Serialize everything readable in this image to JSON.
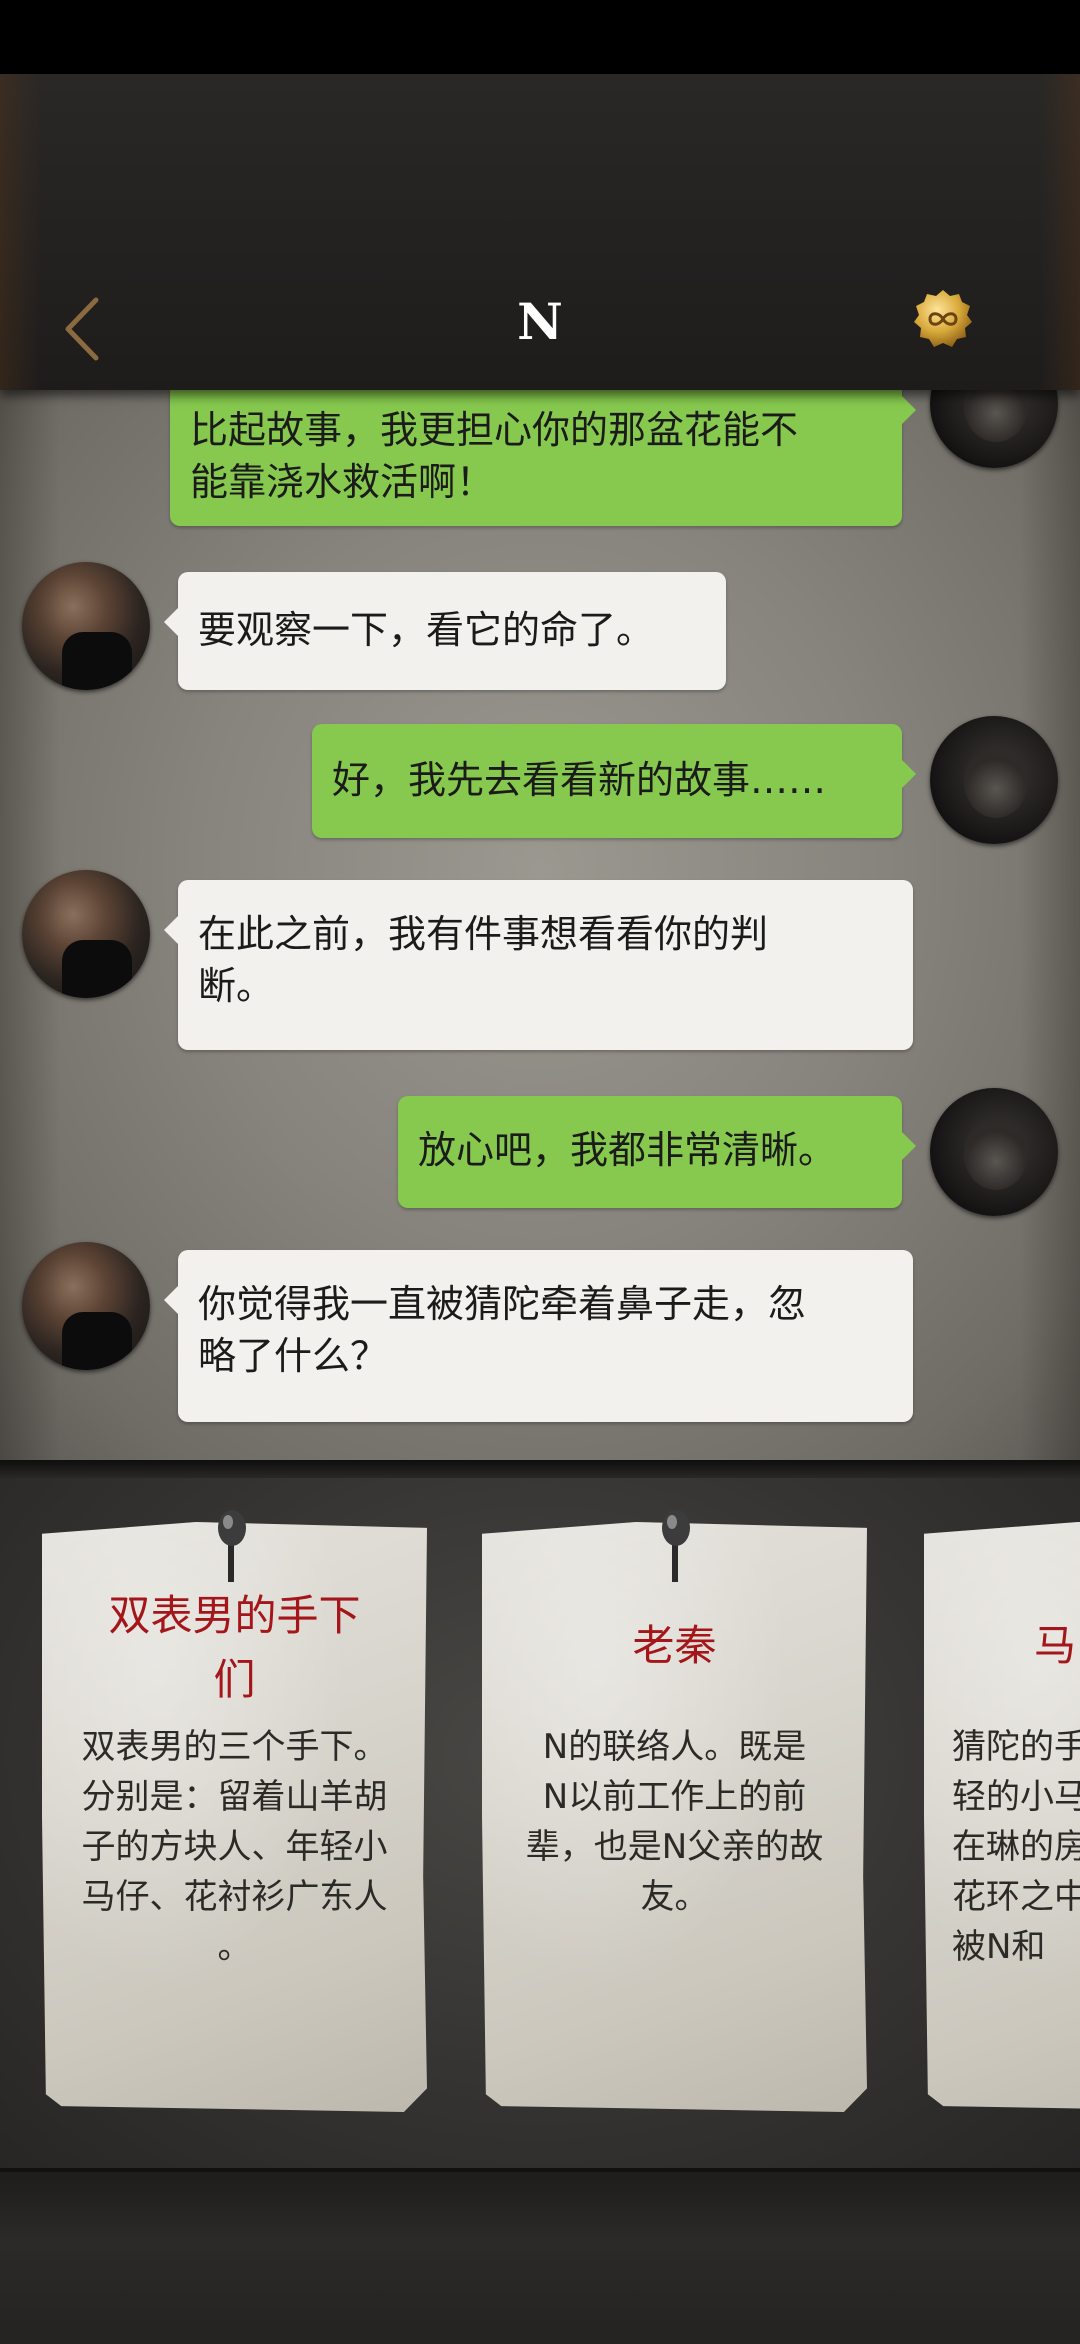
{
  "header": {
    "title": "N",
    "back_icon": "chevron-left-icon",
    "coin_icon": "infinity-coin-icon",
    "colors": {
      "back": "#8a6a3e",
      "coin": "#d8a93a"
    }
  },
  "chat": {
    "messages": [
      {
        "sender": "me",
        "text": "比起故事，我更担心你的那盆花能不\n能靠浇水救活啊！"
      },
      {
        "sender": "n",
        "text": "要观察一下，看它的命了。"
      },
      {
        "sender": "me",
        "text": "好，我先去看看新的故事……"
      },
      {
        "sender": "n",
        "text": "在此之前，我有件事想看看你的判\n断。"
      },
      {
        "sender": "me",
        "text": "放心吧，我都非常清晰。"
      },
      {
        "sender": "n",
        "text": "你觉得我一直被猜陀牵着鼻子走，忽\n略了什么？"
      }
    ],
    "colors": {
      "mine": "#86c94e",
      "theirs": "#f2f1ee"
    }
  },
  "cards": [
    {
      "title": "双表男的手下\n们",
      "desc": "双表男的三个手下。\n分别是：留着山羊胡\n子的方块人、年轻小\n马仔、花衬衫广东人\n。"
    },
    {
      "title": "老秦",
      "desc": "N的联络人。既是\nN以前工作上的前\n辈，也是N父亲的故\n友。"
    },
    {
      "title": "马",
      "desc": "猜陀的手\n轻的小马\n在琳的房\n花环之中\n被N和"
    }
  ],
  "card_title_color": "#a4161a"
}
